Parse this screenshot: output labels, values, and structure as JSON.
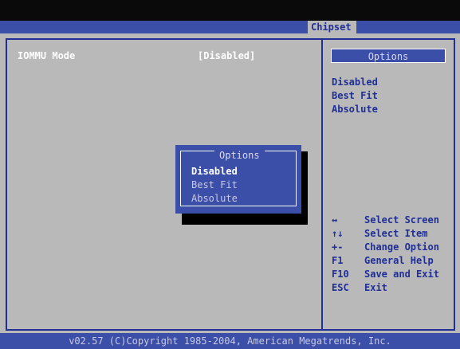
{
  "header": {
    "tab": "Chipset"
  },
  "setting": {
    "label": "IOMMU Mode",
    "value": "[Disabled]"
  },
  "help": {
    "header": "Options",
    "options": [
      "Disabled",
      "Best Fit",
      "Absolute"
    ],
    "keys": [
      {
        "key": "↔",
        "desc": "Select Screen"
      },
      {
        "key": "↑↓",
        "desc": "Select Item"
      },
      {
        "key": "+-",
        "desc": "Change Option"
      },
      {
        "key": "F1",
        "desc": "General Help"
      },
      {
        "key": "F10",
        "desc": "Save and Exit"
      },
      {
        "key": "ESC",
        "desc": "Exit"
      }
    ]
  },
  "popup": {
    "title": "Options",
    "items": [
      "Disabled",
      "Best Fit",
      "Absolute"
    ],
    "selected_index": 0
  },
  "footer": {
    "text": "v02.57 (C)Copyright 1985-2004, American Megatrends, Inc."
  },
  "colors": {
    "bios_blue": "#3b4ea8",
    "bios_gray": "#b9b9b9",
    "highlight": "#ffffff",
    "text_blue": "#1f2f95"
  }
}
